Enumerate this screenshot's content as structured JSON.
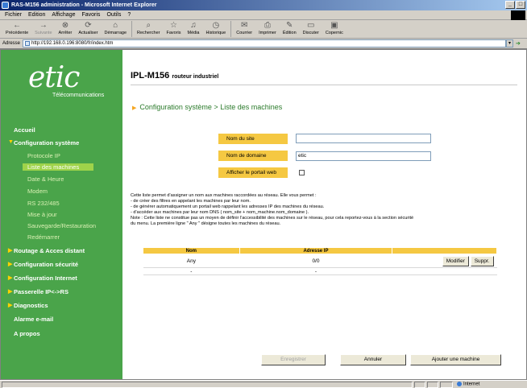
{
  "window": {
    "title": "RAS-M156 administration - Microsoft Internet Explorer"
  },
  "menu": [
    "Fichier",
    "Edition",
    "Affichage",
    "Favoris",
    "Outils",
    "?"
  ],
  "toolbar": [
    {
      "label": "Précédente",
      "icon": "back-arrow-icon"
    },
    {
      "label": "Suivante",
      "icon": "forward-arrow-icon"
    },
    {
      "label": "Arrêter",
      "icon": "stop-icon"
    },
    {
      "label": "Actualiser",
      "icon": "refresh-icon"
    },
    {
      "label": "Démarrage",
      "icon": "home-icon"
    },
    {
      "label": "Rechercher",
      "icon": "search-icon"
    },
    {
      "label": "Favoris",
      "icon": "favorites-icon"
    },
    {
      "label": "Média",
      "icon": "media-icon"
    },
    {
      "label": "Historique",
      "icon": "history-icon"
    },
    {
      "label": "Courrier",
      "icon": "mail-icon"
    },
    {
      "label": "Imprimer",
      "icon": "print-icon"
    },
    {
      "label": "Édition",
      "icon": "edit-icon"
    },
    {
      "label": "Discuter",
      "icon": "discuss-icon"
    },
    {
      "label": "Copernic",
      "icon": "copernic-icon"
    }
  ],
  "address": {
    "label": "Adresse",
    "url": "http://192.168.0.196:8080/fr/index.htm"
  },
  "logo": {
    "brand": "etic",
    "sub": "Télécommunications"
  },
  "sidebar": [
    {
      "label": "Accueil",
      "type": "bold"
    },
    {
      "label": "Configuration système",
      "type": "bold-open"
    },
    {
      "label": "Protocole IP",
      "type": "sub"
    },
    {
      "label": "Liste des machines",
      "type": "active"
    },
    {
      "label": "Date & Heure",
      "type": "sub"
    },
    {
      "label": "Modem",
      "type": "sub"
    },
    {
      "label": "RS 232/485",
      "type": "sub"
    },
    {
      "label": "Mise à jour",
      "type": "sub"
    },
    {
      "label": "Sauvegarde/Restauration",
      "type": "sub"
    },
    {
      "label": "Redémarrer",
      "type": "sub"
    },
    {
      "label": "Routage & Acces distant",
      "type": "bold-arrow"
    },
    {
      "label": "Configuration sécurité",
      "type": "bold-arrow"
    },
    {
      "label": "Configuration Internet",
      "type": "bold-arrow"
    },
    {
      "label": "Passerelle IP<->RS",
      "type": "bold-arrow"
    },
    {
      "label": "Diagnostics",
      "type": "bold-arrow"
    },
    {
      "label": "Alarme e-mail",
      "type": "bold"
    },
    {
      "label": "A propos",
      "type": "bold"
    }
  ],
  "main": {
    "product": "IPL-M156",
    "product_sub": "routeur industriel",
    "breadcrumb": "Configuration système > Liste des machines",
    "site_label": "Nom du site",
    "site_value": "",
    "domain_label": "Nom de domaine",
    "domain_value": "etic",
    "portal_label": "Afficher le portail web",
    "description": [
      "Cette liste permet d'assigner un nom aux machines raccordées au réseau. Elle vous permet :",
      "- de créer des filtres en appelant les machines par leur nom.",
      "- de générer automatiquement un portail web rappelant les adresses IP des machines du réseau.",
      "- d'accéder aux machines par leur nom DNS ( nom_site + nom_machine.nom_domaine ).",
      "Note : Cette liste ne constitue pas un moyen de définir l'accessibilité des machines sur le réseau, pour cela reportez-vous à la section sécurité",
      "du menu. La première ligne \" Any \" désigne toutes les machines du réseau."
    ],
    "table": {
      "headers": [
        "Nom",
        "Adresse IP",
        ""
      ],
      "rows": [
        {
          "nom": "Any",
          "ip": "0/0"
        },
        {
          "nom": "-",
          "ip": "-"
        }
      ],
      "modify_label": "Modifier",
      "delete_label": "Suppr."
    },
    "buttons": {
      "save": "Enregistrer",
      "cancel": "Annuler",
      "add": "Ajouter une machine"
    }
  },
  "status": {
    "zone": "Internet"
  }
}
